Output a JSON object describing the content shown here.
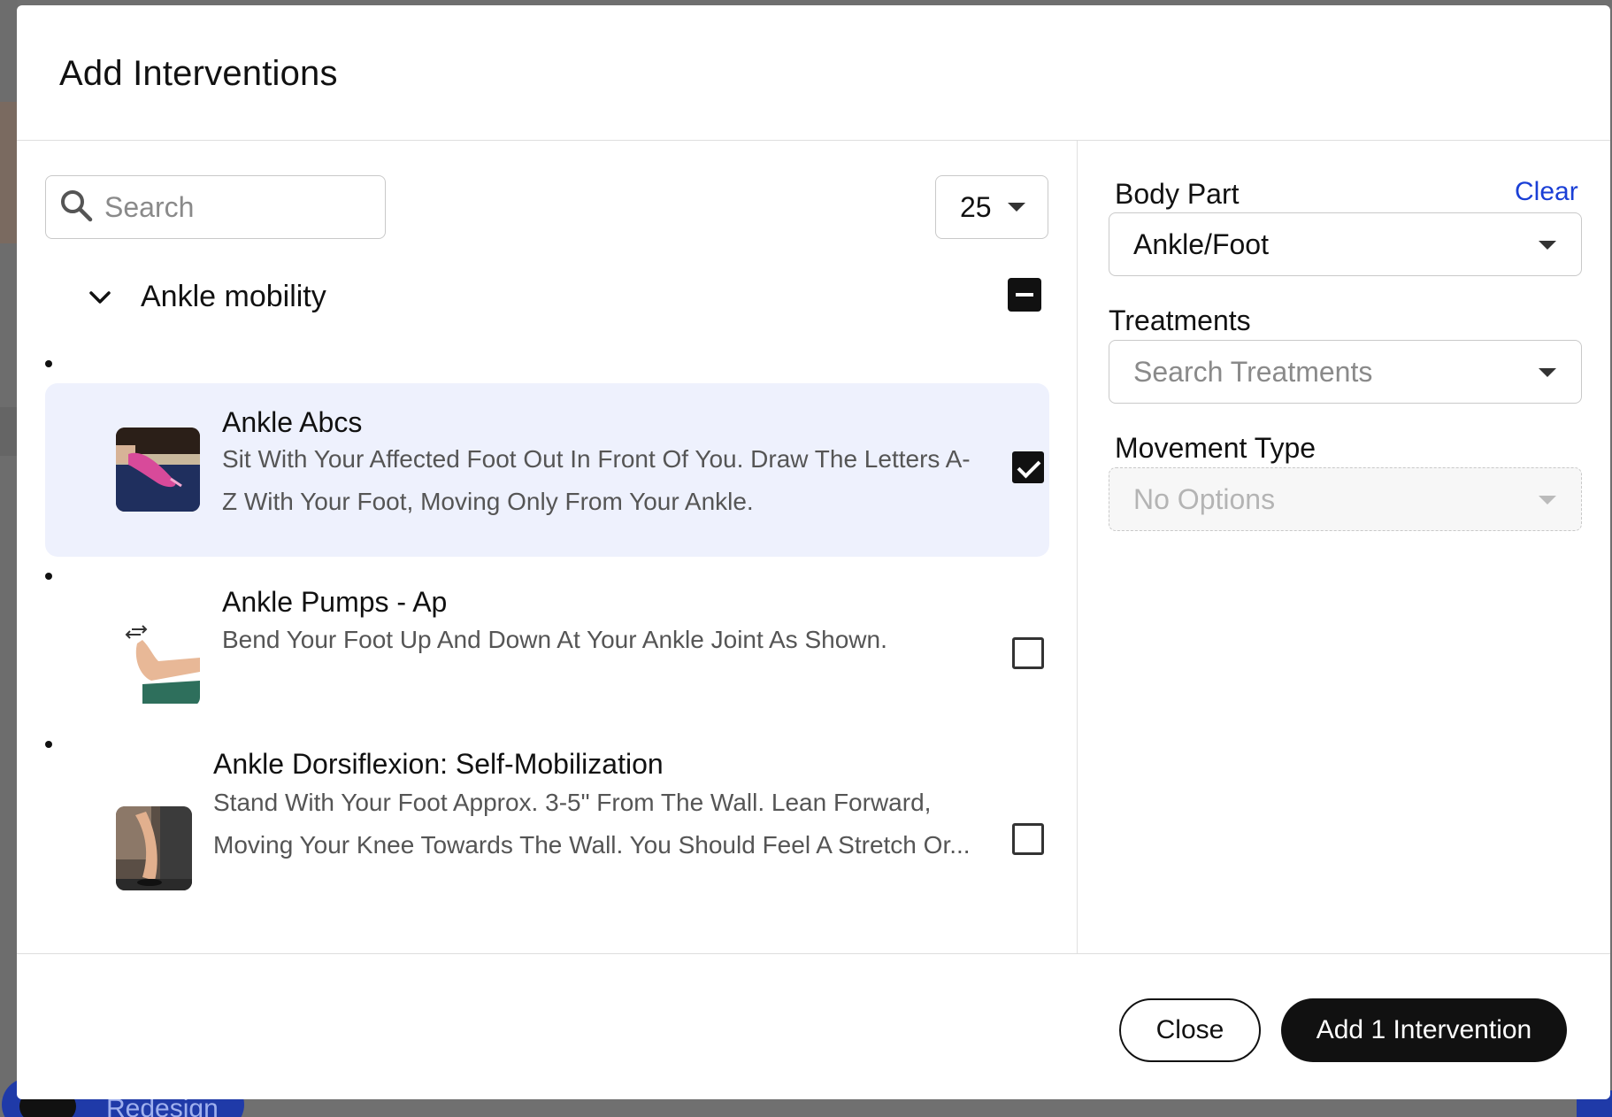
{
  "background": {
    "toggle_label": "Redesign",
    "accent": "#1f3aa8"
  },
  "modal": {
    "title": "Add Interventions"
  },
  "list_controls": {
    "search_placeholder": "Search",
    "page_size": "25"
  },
  "group": {
    "label": "Ankle mobility",
    "state": "partial"
  },
  "items": [
    {
      "title": "Ankle Abcs",
      "desc_line1": "Sit With Your Affected Foot Out In Front Of You. Draw The Letters A-",
      "desc_line2": "Z With Your Foot, Moving Only From Your Ankle.",
      "checked": true
    },
    {
      "title": "Ankle Pumps - Ap",
      "desc_line1": "Bend Your Foot Up And Down At Your Ankle Joint As Shown.",
      "desc_line2": "",
      "checked": false
    },
    {
      "title": "Ankle Dorsiflexion: Self-Mobilization",
      "desc_line1": "Stand With Your Foot Approx. 3-5\" From The Wall. Lean Forward,",
      "desc_line2": "Moving Your Knee Towards The Wall. You Should Feel A Stretch Or...",
      "checked": false
    }
  ],
  "filters": {
    "body_part": {
      "label": "Body Part",
      "value": "Ankle/Foot",
      "clear_label": "Clear"
    },
    "treatments": {
      "label": "Treatments",
      "placeholder": "Search Treatments"
    },
    "movement_type": {
      "label": "Movement Type",
      "placeholder": "No Options"
    }
  },
  "footer": {
    "close_label": "Close",
    "submit_label": "Add 1 Intervention"
  },
  "colors": {
    "selected_row": "#eef1fd",
    "link": "#1a3fd6",
    "primary": "#111111"
  }
}
